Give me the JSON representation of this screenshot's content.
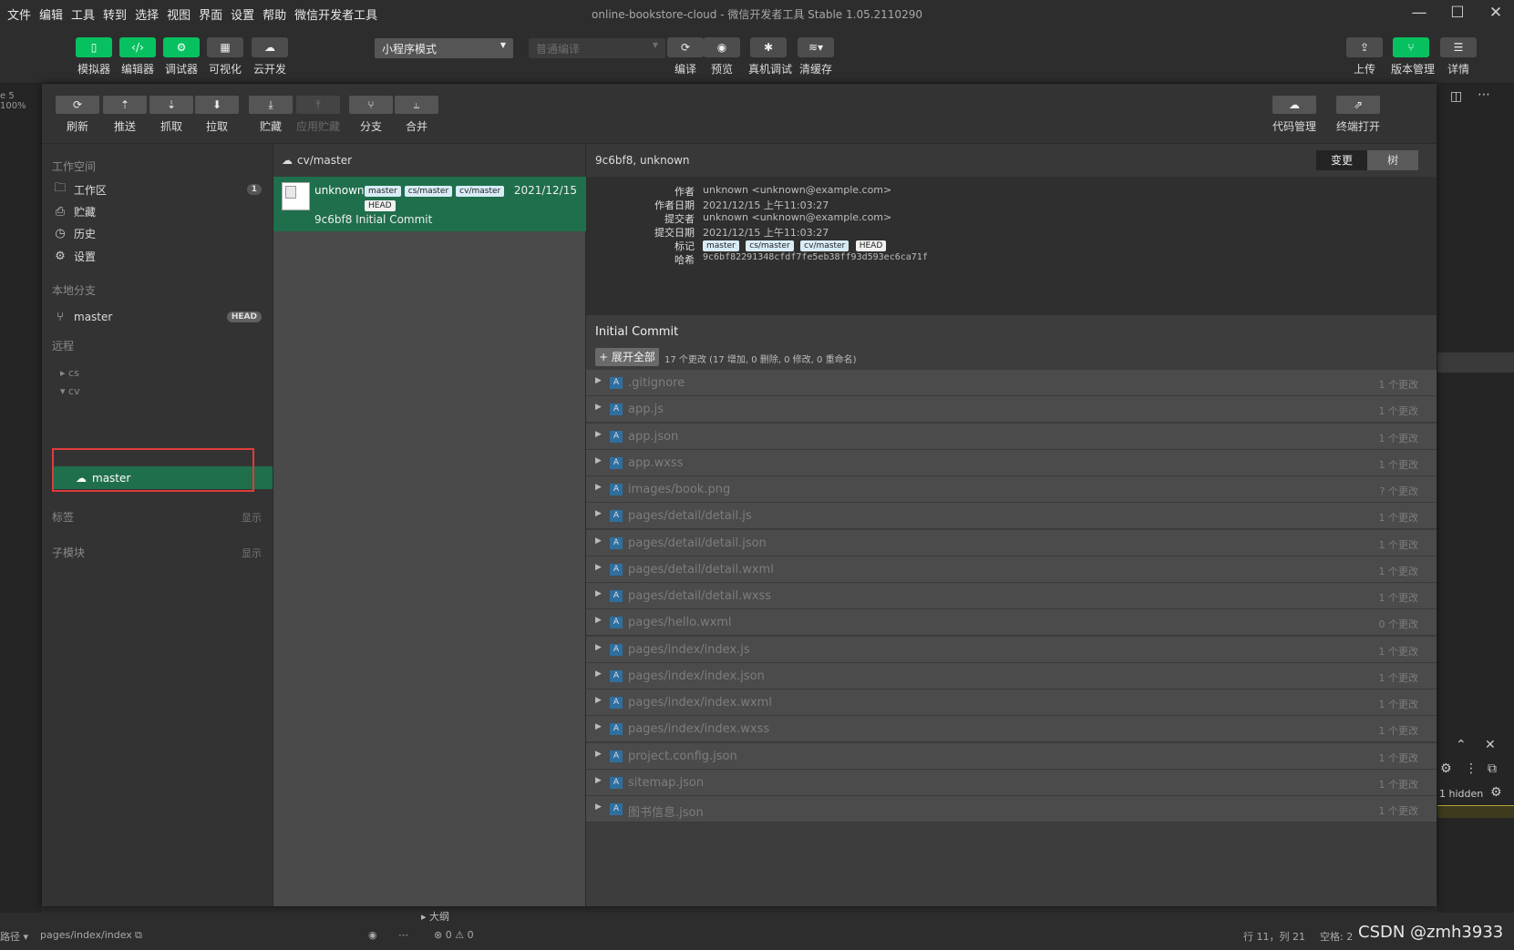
{
  "window": {
    "menu": [
      "文件",
      "编辑",
      "工具",
      "转到",
      "选择",
      "视图",
      "界面",
      "设置",
      "帮助",
      "微信开发者工具"
    ],
    "title": "online-bookstore-cloud - 微信开发者工具 Stable 1.05.2110290",
    "controls": [
      "—",
      "☐",
      "✕"
    ]
  },
  "toolbar": {
    "left_tools": [
      {
        "label": "模拟器",
        "icon": "phone-icon"
      },
      {
        "label": "编辑器",
        "icon": "code-icon"
      },
      {
        "label": "调试器",
        "icon": "debug-icon"
      },
      {
        "label": "可视化",
        "icon": "layout-icon"
      },
      {
        "label": "云开发",
        "icon": "cloud-icon"
      }
    ],
    "mode_select": "小程序模式",
    "compile_select": "普通编译",
    "mid_tools": [
      {
        "label": "编译",
        "icon": "refresh-icon"
      },
      {
        "label": "预览",
        "icon": "eye-icon"
      },
      {
        "label": "真机调试",
        "icon": "bug-icon"
      },
      {
        "label": "清缓存",
        "icon": "layers-icon"
      }
    ],
    "right_tools": [
      {
        "label": "上传",
        "icon": "upload-icon"
      },
      {
        "label": "版本管理",
        "icon": "branch-icon"
      },
      {
        "label": "详情",
        "icon": "menu-icon"
      }
    ]
  },
  "background": {
    "zoom": "e 5 100%",
    "hidden_label": "1 hidden"
  },
  "git": {
    "toolbar": [
      {
        "label": "刷新",
        "icon": "refresh-icon",
        "enabled": true
      },
      {
        "label": "推送",
        "icon": "push-icon",
        "enabled": true
      },
      {
        "label": "抓取",
        "icon": "fetch-icon",
        "enabled": true
      },
      {
        "label": "拉取",
        "icon": "pull-icon",
        "enabled": true
      },
      {
        "label": "贮藏",
        "icon": "stash-icon",
        "enabled": true
      },
      {
        "label": "应用贮藏",
        "icon": "apply-stash-icon",
        "enabled": false
      },
      {
        "label": "分支",
        "icon": "branch-icon",
        "enabled": true
      },
      {
        "label": "合并",
        "icon": "merge-icon",
        "enabled": true
      }
    ],
    "toolbar_right": [
      {
        "label": "代码管理",
        "icon": "cloud-sync-icon"
      },
      {
        "label": "终端打开",
        "icon": "external-link-icon"
      }
    ],
    "sidebar": {
      "workspace_title": "工作空间",
      "workspace_items": [
        {
          "label": "工作区",
          "icon": "folder-icon",
          "badge": "1"
        },
        {
          "label": "贮藏",
          "icon": "stash-icon",
          "badge": ""
        },
        {
          "label": "历史",
          "icon": "history-icon",
          "badge": ""
        },
        {
          "label": "设置",
          "icon": "gear-icon",
          "badge": ""
        }
      ],
      "local_title": "本地分支",
      "local_branch": {
        "label": "master",
        "badge": "HEAD"
      },
      "remote_title": "远程",
      "remote_groups": [
        "cs",
        "cv"
      ],
      "remote_selected_branch": "master",
      "tags_title": "标签",
      "tags_toggle": "显示",
      "submodules_title": "子模块",
      "submodules_toggle": "显示"
    },
    "commit_list": {
      "header": "cv/master",
      "commits": [
        {
          "author": "unknown",
          "tags": [
            "master",
            "cs/master",
            "cv/master",
            "HEAD"
          ],
          "date": "2021/12/15",
          "hash": "9c6bf8",
          "message": "Initial Commit"
        }
      ]
    },
    "details": {
      "header": "9c6bf8, unknown",
      "view_toggle": [
        "变更",
        "树"
      ],
      "meta": {
        "author_label": "作者",
        "author": "unknown <unknown@example.com>",
        "author_date_label": "作者日期",
        "author_date": "2021/12/15 上午11:03:27",
        "committer_label": "提交者",
        "committer": "unknown <unknown@example.com>",
        "commit_date_label": "提交日期",
        "commit_date": "2021/12/15 上午11:03:27",
        "refs_label": "标记",
        "refs": [
          "master",
          "cs/master",
          "cv/master",
          "HEAD"
        ],
        "hash_label": "哈希",
        "hash": "9c6bf82291348cfdf7fe5eb38ff93d593ec6ca71f"
      },
      "summary_title": "Initial Commit",
      "expand_all": "+ 展开全部",
      "change_summary": "17 个更改 (17 增加, 0 删除, 0 修改, 0 重命名)",
      "files": [
        {
          "status": "A",
          "name": ".gitignore",
          "changes": "1 个更改"
        },
        {
          "status": "A",
          "name": "app.js",
          "changes": "1 个更改"
        },
        {
          "status": "A",
          "name": "app.json",
          "changes": "1 个更改"
        },
        {
          "status": "A",
          "name": "app.wxss",
          "changes": "1 个更改"
        },
        {
          "status": "A",
          "name": "images/book.png",
          "changes": "? 个更改"
        },
        {
          "status": "A",
          "name": "pages/detail/detail.js",
          "changes": "1 个更改"
        },
        {
          "status": "A",
          "name": "pages/detail/detail.json",
          "changes": "1 个更改"
        },
        {
          "status": "A",
          "name": "pages/detail/detail.wxml",
          "changes": "1 个更改"
        },
        {
          "status": "A",
          "name": "pages/detail/detail.wxss",
          "changes": "1 个更改"
        },
        {
          "status": "A",
          "name": "pages/hello.wxml",
          "changes": "0 个更改"
        },
        {
          "status": "A",
          "name": "pages/index/index.js",
          "changes": "1 个更改"
        },
        {
          "status": "A",
          "name": "pages/index/index.json",
          "changes": "1 个更改"
        },
        {
          "status": "A",
          "name": "pages/index/index.wxml",
          "changes": "1 个更改"
        },
        {
          "status": "A",
          "name": "pages/index/index.wxss",
          "changes": "1 个更改"
        },
        {
          "status": "A",
          "name": "project.config.json",
          "changes": "1 个更改"
        },
        {
          "status": "A",
          "name": "sitemap.json",
          "changes": "1 个更改"
        },
        {
          "status": "A",
          "name": "图书信息.json",
          "changes": "1 个更改"
        }
      ]
    }
  },
  "statusbar": {
    "path_label": "路径 ▾",
    "path": "pages/index/index",
    "problems": "⊗ 0 ⚠ 0",
    "outline": "大纲",
    "position": "行 11，列 21",
    "spaces": "空格: 2"
  },
  "watermark": "CSDN @zmh3933",
  "colors": {
    "accent_green": "#07c160",
    "selected_row": "#1f6f4c",
    "highlight_box": "#e03b3b"
  }
}
